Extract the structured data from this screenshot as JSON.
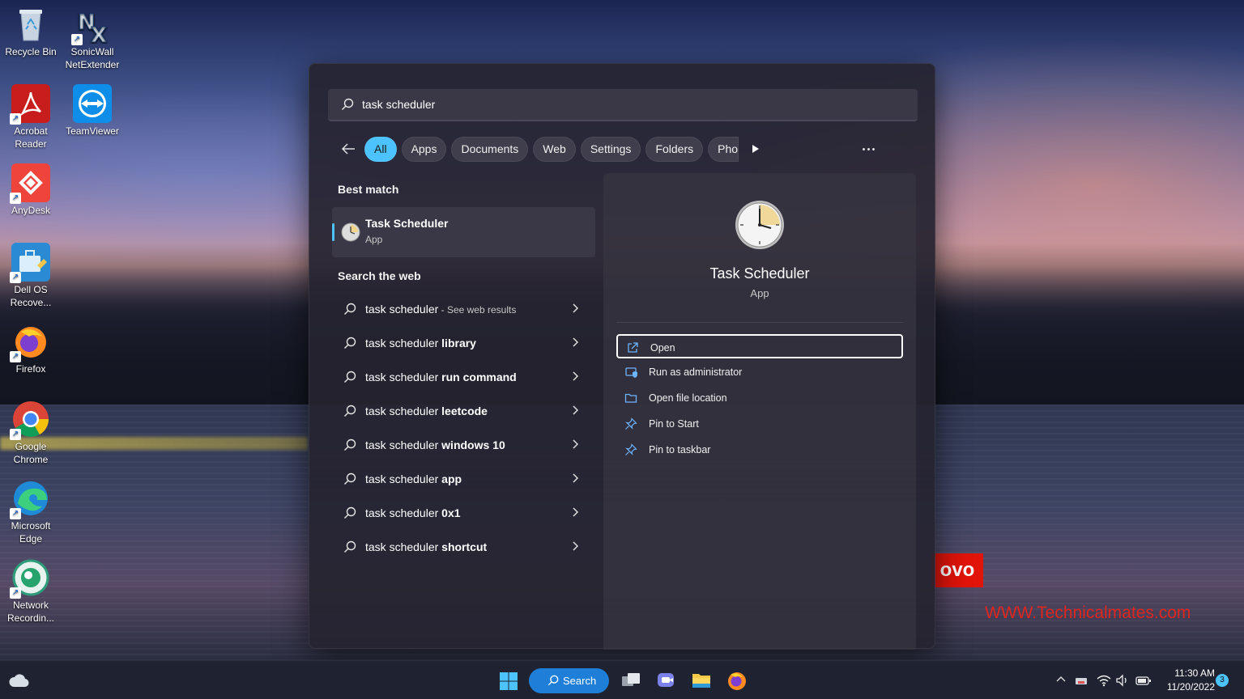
{
  "desktop": {
    "icons": [
      {
        "label": "Recycle Bin",
        "icon": "recycle-bin-icon"
      },
      {
        "label": "SonicWall NetExtender",
        "icon": "sonicwall-icon"
      },
      {
        "label": "Acrobat Reader",
        "icon": "acrobat-icon"
      },
      {
        "label": "TeamViewer",
        "icon": "teamviewer-icon"
      },
      {
        "label": "AnyDesk",
        "icon": "anydesk-icon"
      },
      {
        "label": "Dell OS Recove...",
        "icon": "dell-recovery-icon"
      },
      {
        "label": "Firefox",
        "icon": "firefox-icon"
      },
      {
        "label": "Google Chrome",
        "icon": "chrome-icon"
      },
      {
        "label": "Microsoft Edge",
        "icon": "edge-icon"
      },
      {
        "label": "Network Recordin...",
        "icon": "network-recording-icon"
      }
    ],
    "brand_badge": "ovo",
    "watermark": "WWW.Technicalmates.com"
  },
  "search": {
    "query": "task scheduler",
    "filters": [
      {
        "label": "All",
        "active": true
      },
      {
        "label": "Apps",
        "active": false
      },
      {
        "label": "Documents",
        "active": false
      },
      {
        "label": "Web",
        "active": false
      },
      {
        "label": "Settings",
        "active": false
      },
      {
        "label": "Folders",
        "active": false
      },
      {
        "label": "Pho",
        "active": false
      }
    ],
    "best_match_title": "Best match",
    "best_match": {
      "name": "Task Scheduler",
      "type": "App"
    },
    "web_title": "Search the web",
    "web_results": [
      {
        "prefix": "task scheduler",
        "bold": "",
        "hint": " - See web results"
      },
      {
        "prefix": "task scheduler ",
        "bold": "library",
        "hint": ""
      },
      {
        "prefix": "task scheduler ",
        "bold": "run command",
        "hint": ""
      },
      {
        "prefix": "task scheduler ",
        "bold": "leetcode",
        "hint": ""
      },
      {
        "prefix": "task scheduler ",
        "bold": "windows 10",
        "hint": ""
      },
      {
        "prefix": "task scheduler ",
        "bold": "app",
        "hint": ""
      },
      {
        "prefix": "task scheduler ",
        "bold": "0x1",
        "hint": ""
      },
      {
        "prefix": "task scheduler ",
        "bold": "shortcut",
        "hint": ""
      }
    ],
    "detail": {
      "name": "Task Scheduler",
      "type": "App",
      "actions": [
        {
          "label": "Open",
          "icon": "open-external-icon",
          "focused": true
        },
        {
          "label": "Run as administrator",
          "icon": "shield-admin-icon",
          "focused": false
        },
        {
          "label": "Open file location",
          "icon": "folder-icon",
          "focused": false
        },
        {
          "label": "Pin to Start",
          "icon": "pin-icon",
          "focused": false
        },
        {
          "label": "Pin to taskbar",
          "icon": "pin-icon",
          "focused": false
        }
      ]
    }
  },
  "taskbar": {
    "search_label": "Search",
    "time": "11:30 AM",
    "date": "11/20/2022",
    "notification_count": "3"
  },
  "colors": {
    "accent": "#4cc2ff",
    "taskbar_search": "#1f7fd8",
    "watermark": "#e0261f"
  }
}
